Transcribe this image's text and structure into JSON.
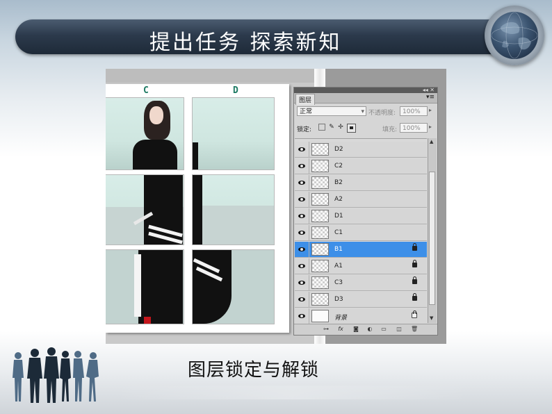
{
  "slide": {
    "title": "提出任务  探索新知",
    "caption": "图层锁定与解锁"
  },
  "canvas": {
    "column_labels": [
      "C",
      "D"
    ]
  },
  "layers_panel": {
    "tab_label": "图层",
    "menu_icon": "panel-menu-icon",
    "blend_mode": "正常",
    "opacity_label": "不透明度:",
    "opacity_value": "100%",
    "lock_label": "锁定:",
    "fill_label": "填充:",
    "fill_value": "100%",
    "layers": [
      {
        "name": "D2",
        "selected": false,
        "locked": false
      },
      {
        "name": "C2",
        "selected": false,
        "locked": false
      },
      {
        "name": "B2",
        "selected": false,
        "locked": false
      },
      {
        "name": "A2",
        "selected": false,
        "locked": false
      },
      {
        "name": "D1",
        "selected": false,
        "locked": false
      },
      {
        "name": "C1",
        "selected": false,
        "locked": false
      },
      {
        "name": "B1",
        "selected": true,
        "locked": true
      },
      {
        "name": "A1",
        "selected": false,
        "locked": true
      },
      {
        "name": "C3",
        "selected": false,
        "locked": true
      },
      {
        "name": "D3",
        "selected": false,
        "locked": true
      },
      {
        "name": "背景",
        "selected": false,
        "locked": true,
        "background": true
      }
    ]
  },
  "colors": {
    "banner": "#2c3a4c",
    "selection": "#3d8fe8",
    "column_label": "#1d7a63"
  }
}
